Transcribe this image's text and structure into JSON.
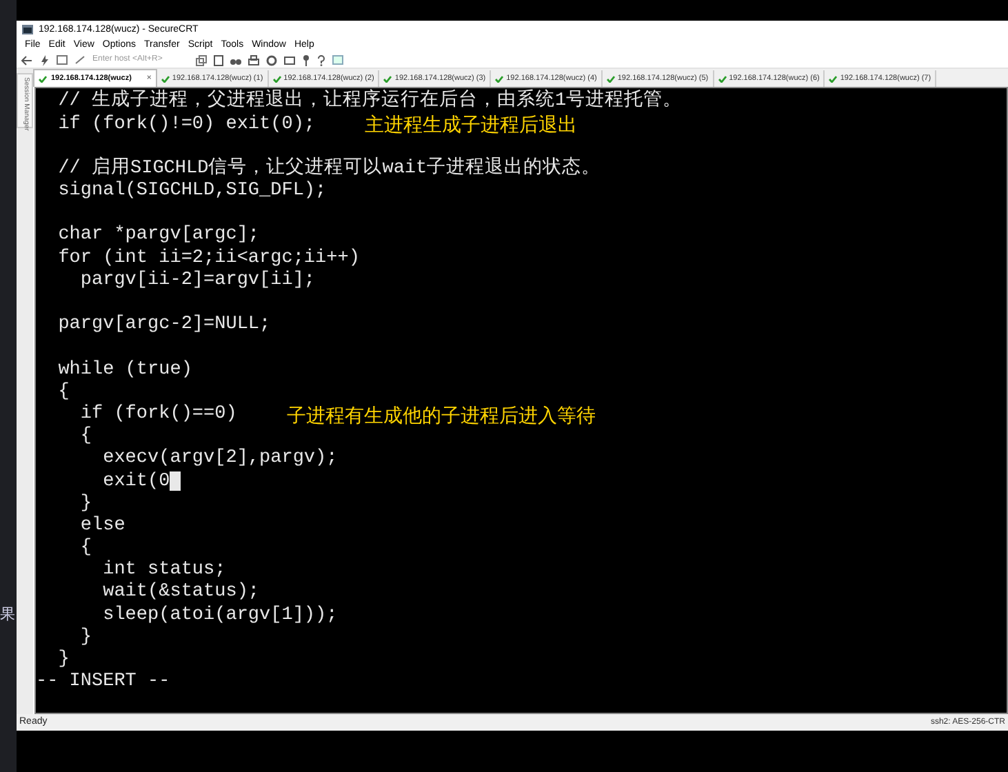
{
  "desktop_text": "果",
  "window": {
    "title": "192.168.174.128(wucz) - SecureCRT"
  },
  "menu": [
    "File",
    "Edit",
    "View",
    "Options",
    "Transfer",
    "Script",
    "Tools",
    "Window",
    "Help"
  ],
  "toolbar": {
    "host_field": {
      "placeholder": "Enter host <Alt+R>"
    }
  },
  "side_tab": "Session Manager",
  "tabs": [
    {
      "label": "192.168.174.128(wucz)",
      "selected": true,
      "close": "×"
    },
    {
      "label": "192.168.174.128(wucz) (1)",
      "selected": false
    },
    {
      "label": "192.168.174.128(wucz) (2)",
      "selected": false
    },
    {
      "label": "192.168.174.128(wucz) (3)",
      "selected": false
    },
    {
      "label": "192.168.174.128(wucz) (4)",
      "selected": false
    },
    {
      "label": "192.168.174.128(wucz) (5)",
      "selected": false
    },
    {
      "label": "192.168.174.128(wucz) (6)",
      "selected": false
    },
    {
      "label": "192.168.174.128(wucz) (7)",
      "selected": false
    }
  ],
  "terminal": {
    "lines": [
      {
        "text": "  // 生成子进程，父进程退出，让程序运行在后台，由系统1号进程托管。"
      },
      {
        "text": "  if (fork()!=0) exit(0);",
        "note": "主进程生成子进程后退出"
      },
      {
        "text": "  // 启用SIGCHLD信号，让父进程可以wait子进程退出的状态。",
        "blank_line_above": true
      },
      {
        "text": "  signal(SIGCHLD,SIG_DFL);"
      },
      {
        "text": "  char *pargv[argc];",
        "blank_line_above": true
      },
      {
        "text": "  for (int ii=2;ii<argc;ii++)"
      },
      {
        "text": "    pargv[ii-2]=argv[ii];"
      },
      {
        "text": "  pargv[argc-2]=NULL;",
        "blank_line_above": true
      },
      {
        "text": "  while (true)",
        "blank_line_above": true
      },
      {
        "text": "  {"
      },
      {
        "text": "    if (fork()==0)",
        "note": "子进程有生成他的子进程后进入等待"
      },
      {
        "text": "    {"
      },
      {
        "text": "      execv(argv[2],pargv);"
      },
      {
        "text": "      exit(0",
        "cursor": true
      },
      {
        "text": "    }"
      },
      {
        "text": "    else"
      },
      {
        "text": "    {"
      },
      {
        "text": "      int status;"
      },
      {
        "text": "      wait(&status);"
      },
      {
        "text": "      sleep(atoi(argv[1]));"
      },
      {
        "text": "    }"
      },
      {
        "text": "  }"
      },
      {
        "text": "-- INSERT --"
      }
    ]
  },
  "status_bar": {
    "left": "Ready",
    "right": "ssh2: AES-256-CTR"
  }
}
